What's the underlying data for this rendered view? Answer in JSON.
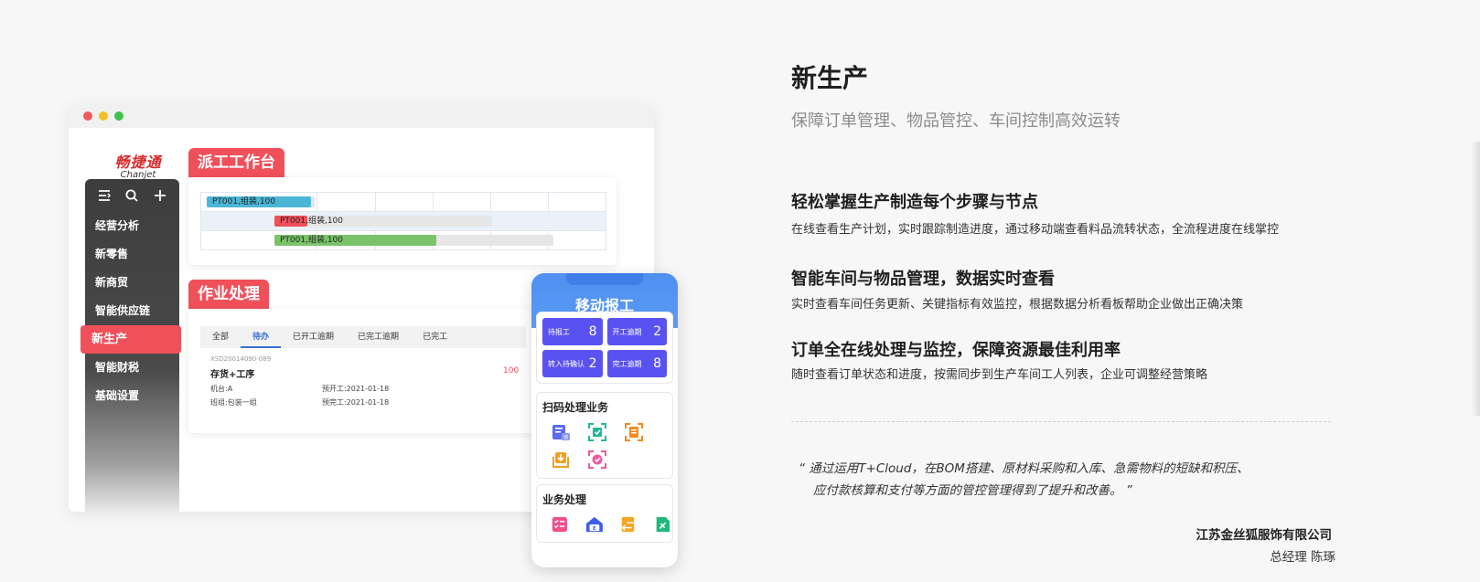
{
  "colors": {
    "accent": "#f0505a",
    "phone_blue": "#4f8ff0",
    "stat_purple": "#5a52f0",
    "tab_active": "#3a6fd8"
  },
  "window": {
    "logo": {
      "cn": "畅捷通",
      "en": "Chanjet"
    },
    "sidebar": {
      "top_icons": [
        "menu-icon",
        "search-icon",
        "plus-icon"
      ],
      "items": [
        {
          "label": "经营分析",
          "active": false
        },
        {
          "label": "新零售",
          "active": false
        },
        {
          "label": "新商贸",
          "active": false
        },
        {
          "label": "智能供应链",
          "active": false
        },
        {
          "label": "新生产",
          "active": true
        },
        {
          "label": "智能财税",
          "active": false
        },
        {
          "label": "基础设置",
          "active": false
        }
      ]
    },
    "dispatch": {
      "tag": "派工工作台",
      "rows": [
        {
          "label": "PT001,组装,100",
          "color": "#4bb7d6",
          "progress": 1.0
        },
        {
          "label": "PT001,组装,100",
          "color": "#f0505a",
          "progress": 0.15
        },
        {
          "label": "PT001,组装,100",
          "color": "#7ac36a",
          "progress": 0.58
        }
      ]
    },
    "work": {
      "tag": "作业处理",
      "tabs": [
        {
          "label": "全部",
          "active": false
        },
        {
          "label": "待办",
          "active": true
        },
        {
          "label": "已开工逾期",
          "active": false
        },
        {
          "label": "已完工逾期",
          "active": false
        },
        {
          "label": "已完工",
          "active": false
        }
      ],
      "order": {
        "id": "XSD20014090-089",
        "title": "存货+工序",
        "qty": "100",
        "machine": "机台:A",
        "team": "班组:包装一组",
        "plan_start": "预开工:2021-01-18",
        "plan_end": "预完工:2021-01-18"
      }
    }
  },
  "phone": {
    "title": "移动报工",
    "stats": [
      {
        "label": "待报工",
        "value": "8"
      },
      {
        "label": "开工逾期",
        "value": "2"
      },
      {
        "label": "转入待确认",
        "value": "2"
      },
      {
        "label": "完工逾期",
        "value": "8"
      }
    ],
    "scan": {
      "title": "扫码处理业务",
      "icons": [
        "requisition-icon",
        "scan-code-icon",
        "scan-document-icon",
        "submit-report-icon",
        "scan-confirm-icon"
      ]
    },
    "biz": {
      "title": "业务处理",
      "icons": [
        "checklist-icon",
        "warehouse-icon",
        "transfer-icon",
        "document-tools-icon"
      ]
    }
  },
  "right": {
    "title": "新生产",
    "subtitle": "保障订单管理、物品管控、车间控制高效运转",
    "features": [
      {
        "title": "轻松掌握生产制造每个步骤与节点",
        "desc": "在线查看生产计划，实时跟踪制造进度，通过移动端查看料品流转状态，全流程进度在线掌控"
      },
      {
        "title": "智能车间与物品管理，数据实时查看",
        "desc": "实时查看车间任务更新、关键指标有效监控，根据数据分析看板帮助企业做出正确决策"
      },
      {
        "title": "订单全在线处理与监控，保障资源最佳利用率",
        "desc": "随时查看订单状态和进度，按需同步到生产车间工人列表，企业可调整经营策略"
      }
    ],
    "quote_line1": "“ 通过运用T+Cloud，在BOM搭建、原材料采购和入库、急需物料的短缺和积压、",
    "quote_line2": "应付款核算和支付等方面的管控管理得到了提升和改善。 ”",
    "company": "江苏金丝狐服饰有限公司",
    "person": "总经理 陈琢"
  }
}
